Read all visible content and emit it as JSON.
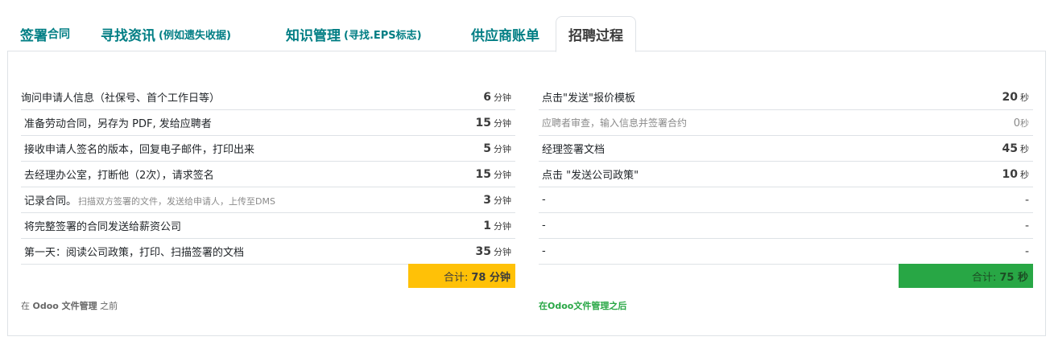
{
  "tabs": [
    {
      "label": "签署",
      "suffix": "合同"
    },
    {
      "label": "寻找资讯",
      "sub": "(例如遗失收据)"
    },
    {
      "label": "知识管理",
      "sub": "(寻找.EPS标志)"
    },
    {
      "label": "供应商账单"
    },
    {
      "label": "招聘过程",
      "active": true
    }
  ],
  "left": {
    "rows": [
      {
        "label": "询问申请人信息（社保号、首个工作日等）",
        "value": "6",
        "unit": "分钟"
      },
      {
        "label": "准备劳动合同，另存为 PDF, 发给应聘者",
        "value": "15",
        "unit": "分钟"
      },
      {
        "label": "接收申请人签名的版本，回复电子邮件，打印出来",
        "value": "5",
        "unit": "分钟"
      },
      {
        "label": "去经理办公室，打断他（2次），请求签名",
        "value": "15",
        "unit": "分钟"
      },
      {
        "label": "记录合同。",
        "small": "扫描双方签署的文件，发送给申请人，上传至DMS",
        "value": "3",
        "unit": "分钟"
      },
      {
        "label": "将完整签署的合同发送给薪资公司",
        "value": "1",
        "unit": "分钟"
      },
      {
        "label": "第一天：阅读公司政策，打印、扫描签署的文档",
        "value": "35",
        "unit": "分钟"
      }
    ],
    "total_label": "合计:",
    "total_value": "78 分钟",
    "note_prefix": "在",
    "note_bold": "Odoo 文件管理",
    "note_suffix": "之前"
  },
  "right": {
    "rows": [
      {
        "label": "点击\"发送\"报价模板",
        "value": "20",
        "unit": "秒"
      },
      {
        "label": "应聘者审查，输入信息并签署合约",
        "value": "0",
        "unit": "秒",
        "muted": true
      },
      {
        "label": "经理签署文档",
        "value": "45",
        "unit": "秒"
      },
      {
        "label": "点击 \"发送公司政策\"",
        "value": "10",
        "unit": "秒"
      },
      {
        "label": "-",
        "value": "-"
      },
      {
        "label": "-",
        "value": "-"
      },
      {
        "label": "-",
        "value": "-"
      }
    ],
    "total_label": "合计:",
    "total_value": "75 秒",
    "note": "在Odoo文件管理之后"
  },
  "colors": {
    "accent": "#017e84",
    "yellow": "#ffc107",
    "green": "#28a745"
  }
}
